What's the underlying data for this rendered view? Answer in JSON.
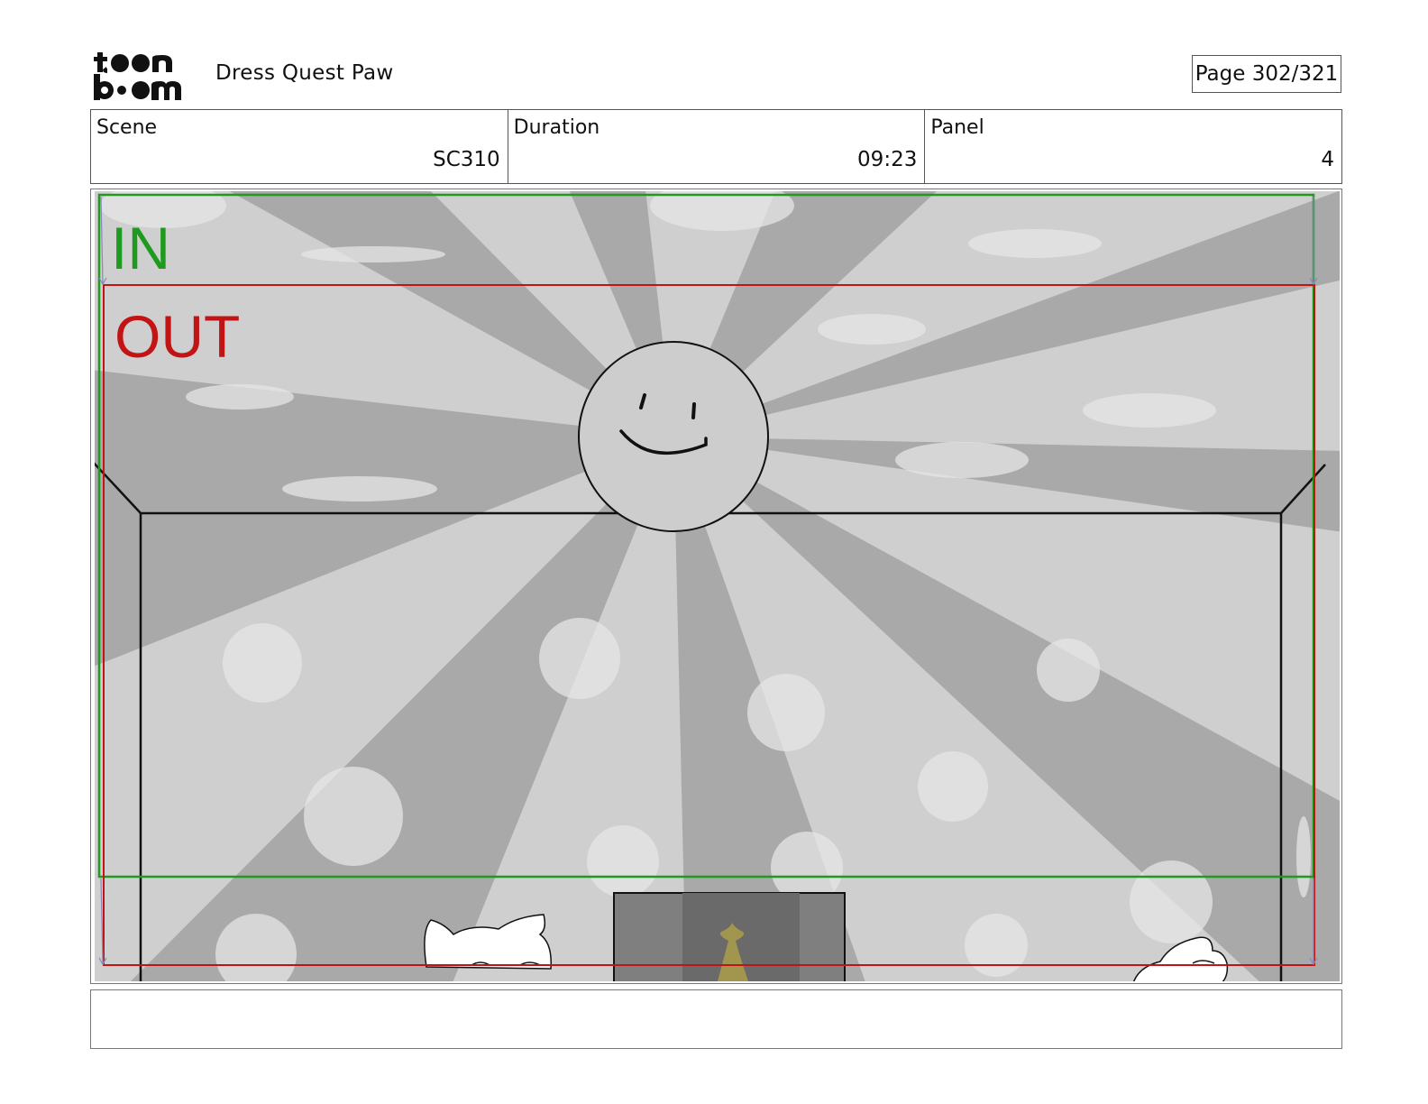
{
  "header": {
    "logo_text_top": "toon",
    "logo_text_bottom": "boom",
    "project_title": "Dress Quest Paw",
    "page_indicator": "Page 302/321"
  },
  "info": {
    "scene_label": "Scene",
    "scene_value": "SC310",
    "duration_label": "Duration",
    "duration_value": "09:23",
    "panel_label": "Panel",
    "panel_value": "4"
  },
  "panel": {
    "in_label": "IN",
    "out_label": "OUT",
    "colors": {
      "in_frame": "#1e9a1e",
      "out_frame": "#c21414",
      "ray_light": "#cfcfcf",
      "ray_dark": "#a9a9a9"
    }
  },
  "notes": {
    "text": ""
  }
}
